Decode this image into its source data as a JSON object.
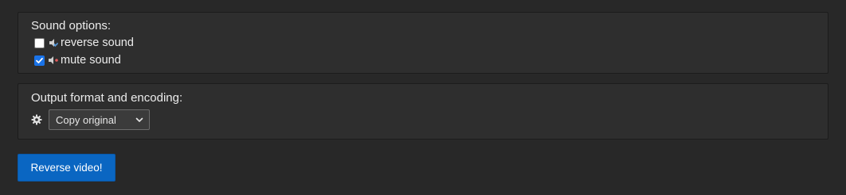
{
  "sound_options": {
    "title": "Sound options:",
    "items": [
      {
        "label": "reverse sound",
        "checked": false,
        "icon": "reverse-sound-icon"
      },
      {
        "label": "mute sound",
        "checked": true,
        "icon": "mute-sound-icon"
      }
    ]
  },
  "output": {
    "title": "Output format and encoding:",
    "icon": "gear-icon",
    "format_select": {
      "selected": "Copy original"
    }
  },
  "action": {
    "label": "Reverse video!"
  },
  "colors": {
    "background": "#282828",
    "panel": "#2e2e2e",
    "accent": "#0a66c2",
    "checkbox_checked": "#1a73e8",
    "mute_dot": "#e05a5a",
    "reverse_arrow": "#5aa0e6"
  }
}
